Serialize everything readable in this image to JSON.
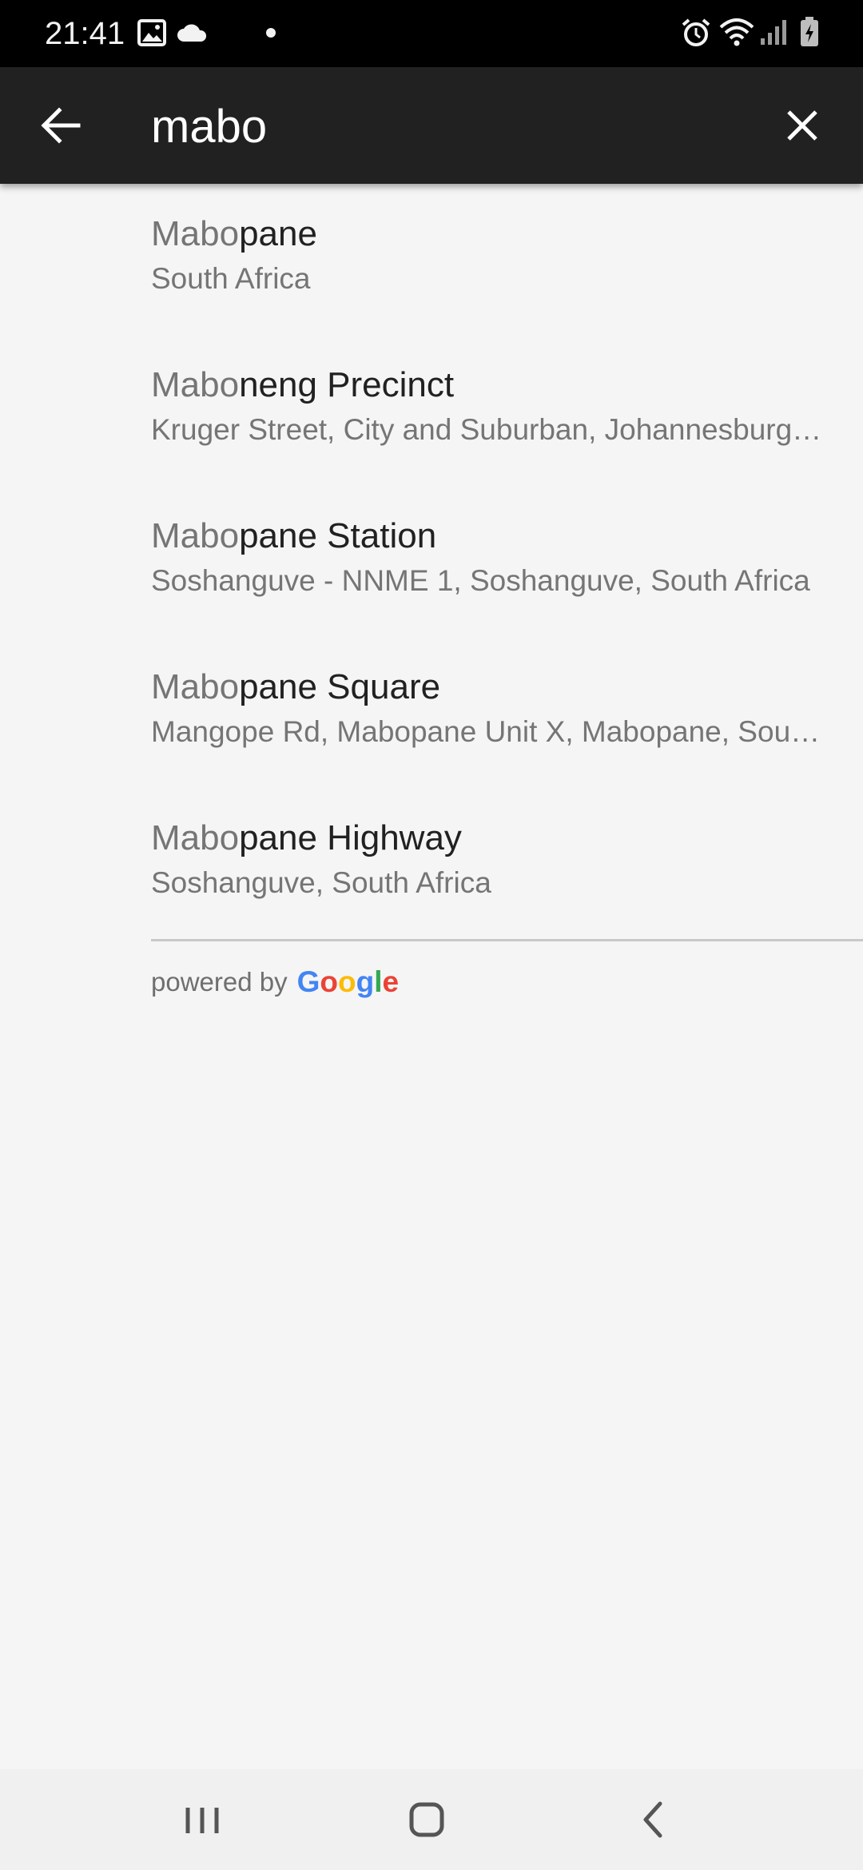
{
  "status_bar": {
    "time": "21:41",
    "left_icons": [
      "image-icon",
      "cloud-icon",
      "dot-icon"
    ],
    "right_icons": [
      "alarm-icon",
      "wifi-icon",
      "signal-icon",
      "battery-charging-icon"
    ]
  },
  "search": {
    "query": "mabo",
    "back_icon": "arrow-back-icon",
    "clear_icon": "close-icon"
  },
  "results": [
    {
      "match": "Mabo",
      "rest": "pane",
      "secondary": "South Africa"
    },
    {
      "match": "Mabo",
      "rest": "neng Precinct",
      "secondary": "Kruger Street, City and Suburban, Johannesburg, South Africa"
    },
    {
      "match": "Mabo",
      "rest": "pane Station",
      "secondary": "Soshanguve - NNME 1, Soshanguve, South Africa"
    },
    {
      "match": "Mabo",
      "rest": "pane Square",
      "secondary": "Mangope Rd, Mabopane Unit X, Mabopane, South Africa"
    },
    {
      "match": "Mabo",
      "rest": "pane Highway",
      "secondary": "Soshanguve, South Africa"
    }
  ],
  "attribution": {
    "prefix": "powered by",
    "brand_letters": [
      {
        "ch": "G",
        "color": "#4285F4"
      },
      {
        "ch": "o",
        "color": "#EA4335"
      },
      {
        "ch": "o",
        "color": "#FBBC05"
      },
      {
        "ch": "g",
        "color": "#4285F4"
      },
      {
        "ch": "l",
        "color": "#34A853"
      },
      {
        "ch": "e",
        "color": "#EA4335"
      }
    ]
  },
  "nav_bar": {
    "icons": [
      "recent-apps-icon",
      "home-icon",
      "back-nav-icon"
    ]
  },
  "colors": {
    "app_bar": "#212121",
    "background": "#f5f5f5",
    "primary_text": "#212121",
    "secondary_text": "#757575"
  }
}
